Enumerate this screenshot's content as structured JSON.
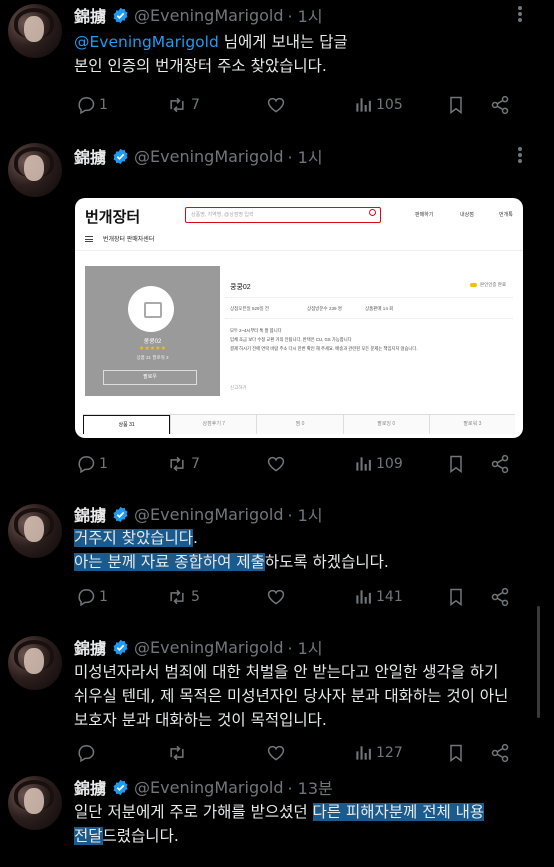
{
  "tweets": [
    {
      "name": "錦擄",
      "handle": "@EveningMarigold",
      "time": "· 1시",
      "reply_mention": "@EveningMarigold",
      "reply_suffix": " 님에게 보내는 답글",
      "line1": "본인 인증의 번개장터 주소 찾았습니다.",
      "replies": "1",
      "retweets": "7",
      "likes": "",
      "views": "105"
    },
    {
      "name": "錦擄",
      "handle": "@EveningMarigold",
      "time": "· 1시",
      "replies": "1",
      "retweets": "7",
      "likes": "",
      "views": "109"
    },
    {
      "name": "錦擄",
      "handle": "@EveningMarigold",
      "time": "· 1시",
      "line1_hl": "거주지 찾았습니다",
      "line1_rest": ".",
      "line2_hl": "아는 분께 자료 종합하여 제출",
      "line2_rest": "하도록 하겠습니다.",
      "replies": "1",
      "retweets": "5",
      "likes": "",
      "views": "141"
    },
    {
      "name": "錦擄",
      "handle": "@EveningMarigold",
      "time": "· 1시",
      "line1": "미성년자라서 범죄에 대한 처벌을 안 받는다고 안일한 생각을 하기",
      "line2": "쉬우실 텐데, 제 목적은 미성년자인 당사자 분과 대화하는 것이 아닌",
      "line3": "보호자 분과 대화하는 것이 목적입니다.",
      "replies": "",
      "retweets": "",
      "likes": "",
      "views": "127"
    },
    {
      "name": "錦擄",
      "handle": "@EveningMarigold",
      "time": "· 13분",
      "line1_pre": "일단 저분에게 주로 가해를 받으셨던 ",
      "line1_hl": "다른 피해자분께 전체 내용",
      "line2_hl": "전달",
      "line2_rest": "드렸습니다."
    }
  ],
  "embedded_shot": {
    "logo": "번개장터",
    "search_placeholder": "상품명, 지역명, @상점명 입력",
    "nav": [
      "판매하기",
      "내상점",
      "번개톡"
    ],
    "menu_label": "번개장터 판매자센터",
    "shop_name": "쿵쿵02",
    "stars": "★★★★★",
    "shop_meta": "상품 31    팔로워 3",
    "follow_button": "팔로우",
    "title": "쿵쿵02",
    "auth_label": "본인인증 완료",
    "stats": [
      "상점오픈일 529일 전",
      "상점방문수 239 명",
      "상품판매 14 회"
    ],
    "desc": [
      "모두 2~4시부터 톡 잘 봅니다",
      "입체 조금 보다 수정 교환 거의 안됩니다. 반택은 CU, GS 가능합니다",
      "결제 하시기 전에 연락 바람 주소 다시 한번 확인 해 주세요. 배송과 관련된 모든 문제는 책임지지 않습니다."
    ],
    "report": "신고하기",
    "tabs": [
      "상품 31",
      "상점후기 7",
      "찜 0",
      "팔로잉 0",
      "팔로워 3"
    ]
  }
}
